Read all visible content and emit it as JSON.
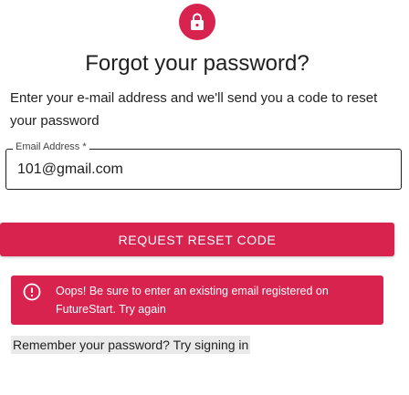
{
  "header": {
    "icon": "lock-icon",
    "accent": "#d9234f",
    "title": "Forgot your password?"
  },
  "instructions": "Enter your e-mail address and we'll send you a code to reset your password",
  "email_field": {
    "label": "Email Address *",
    "value": "101@gmail.com"
  },
  "reset_button": {
    "label": "REQUEST RESET CODE"
  },
  "alert": {
    "icon": "alert-circle-icon",
    "message": "Oops! Be sure to enter an existing email registered on FutureStart. Try again",
    "color": "#d9234f"
  },
  "signin_link": {
    "label": "Remember your password? Try signing in"
  }
}
